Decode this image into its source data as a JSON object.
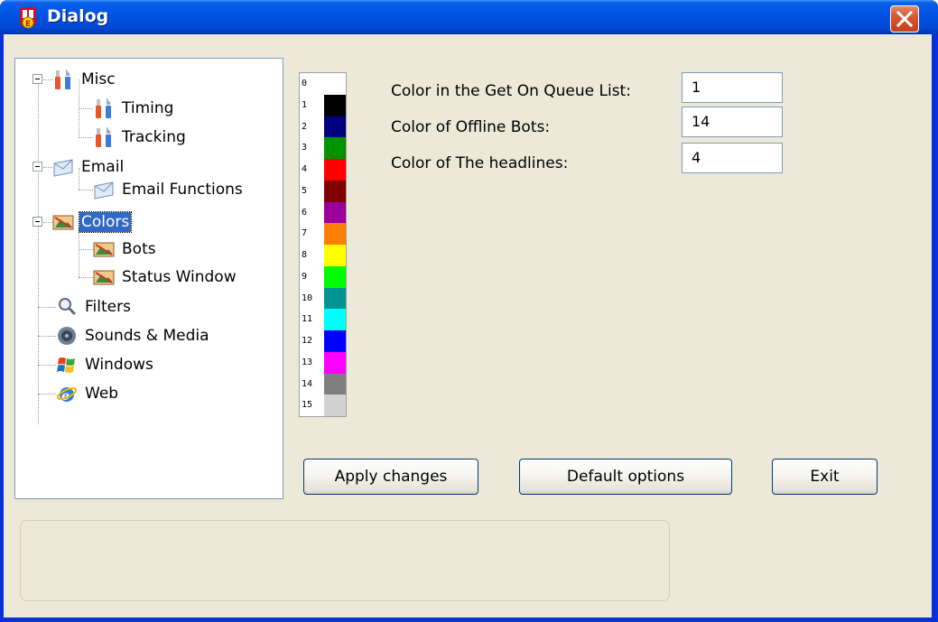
{
  "window": {
    "title": "Dialog",
    "close_label": "✕"
  },
  "tree": {
    "nodes": [
      {
        "label": "Misc",
        "icon": "tools-icon"
      },
      {
        "label": "Timing",
        "icon": "tools-icon"
      },
      {
        "label": "Tracking",
        "icon": "tools-icon"
      },
      {
        "label": "Email",
        "icon": "envelope-icon"
      },
      {
        "label": "Email Functions",
        "icon": "envelope-icon"
      },
      {
        "label": "Colors",
        "icon": "palette-picture-icon"
      },
      {
        "label": "Bots",
        "icon": "palette-picture-icon"
      },
      {
        "label": "Status Window",
        "icon": "palette-picture-icon"
      },
      {
        "label": "Filters",
        "icon": "magnifier-icon"
      },
      {
        "label": "Sounds & Media",
        "icon": "speaker-icon"
      },
      {
        "label": "Windows",
        "icon": "windows-flag-icon"
      },
      {
        "label": "Web",
        "icon": "ie-globe-icon"
      }
    ],
    "selected": "Colors"
  },
  "palette": {
    "numbers": [
      "0",
      "1",
      "2",
      "3",
      "4",
      "5",
      "6",
      "7",
      "8",
      "9",
      "10",
      "11",
      "12",
      "13",
      "14",
      "15"
    ],
    "colors": [
      "#ffffff",
      "#000000",
      "#00007f",
      "#009300",
      "#ff0000",
      "#7f0000",
      "#9c009c",
      "#fc7f00",
      "#ffff00",
      "#00fc00",
      "#009393",
      "#00ffff",
      "#0000fc",
      "#ff00ff",
      "#7f7f7f",
      "#d2d2d2"
    ]
  },
  "fields": [
    {
      "label": "Color in the Get On Queue List:",
      "value": "1"
    },
    {
      "label": "Color of Offline Bots:",
      "value": "14"
    },
    {
      "label": "Color of The headlines:",
      "value": "4"
    }
  ],
  "buttons": {
    "apply": "Apply changes",
    "defaults": "Default options",
    "exit": "Exit"
  },
  "colors": {
    "titlebar": "#0054e3",
    "selection": "#316ac5",
    "dialog_bg": "#ece9d8"
  }
}
